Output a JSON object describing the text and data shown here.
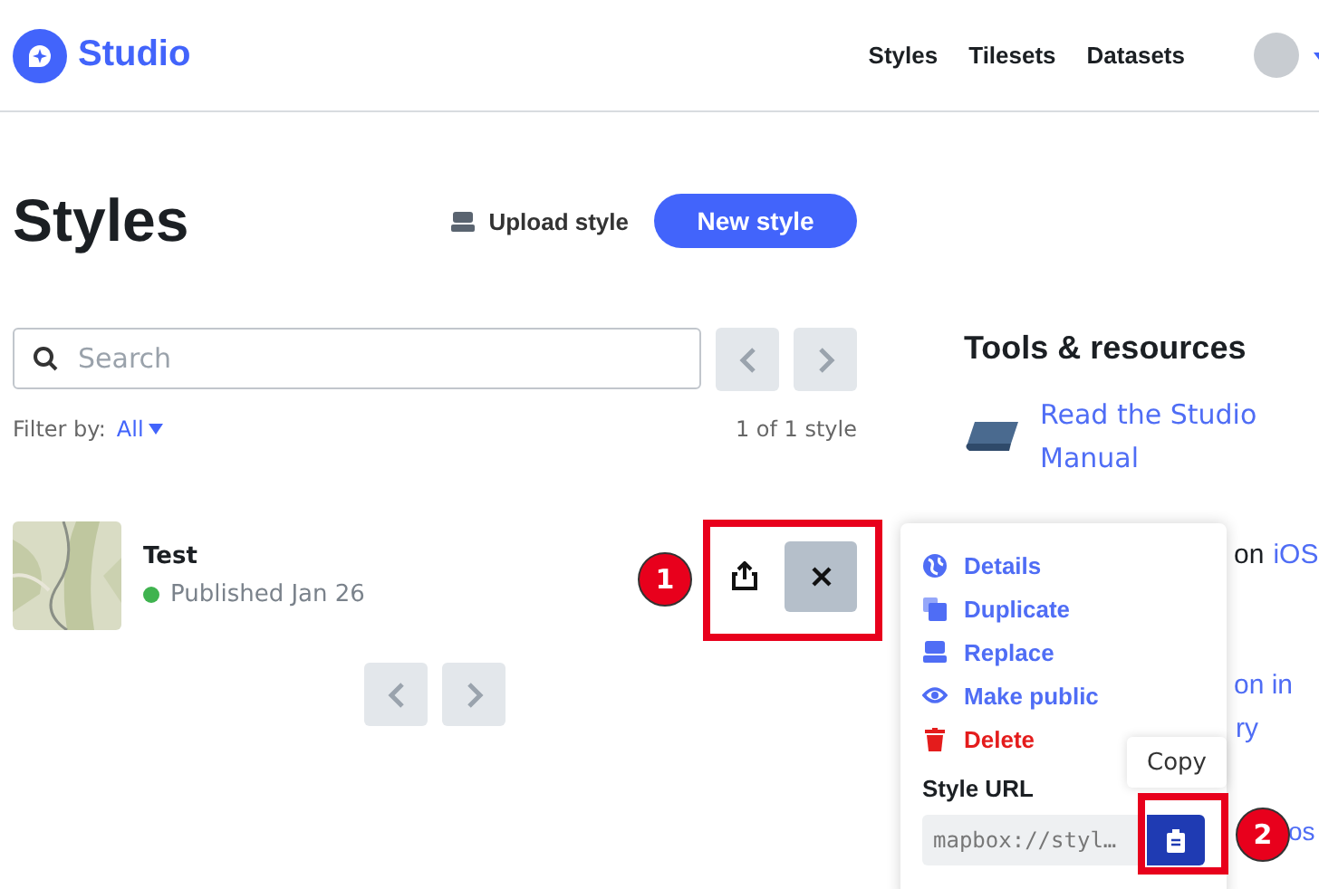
{
  "header": {
    "logo": "Studio",
    "nav": [
      {
        "label": "Styles"
      },
      {
        "label": "Tilesets"
      },
      {
        "label": "Datasets"
      }
    ]
  },
  "page": {
    "title": "Styles",
    "upload": "Upload style",
    "new_style": "New style"
  },
  "search": {
    "placeholder": "Search"
  },
  "filter": {
    "label": "Filter by:",
    "value": "All"
  },
  "count": "1 of 1 style",
  "styles": [
    {
      "name": "Test",
      "status": "Published Jan 26",
      "color": "#3fb34f"
    }
  ],
  "resources": {
    "title": "Tools & resources",
    "items": [
      {
        "text": "Read the Studio Manual"
      }
    ],
    "fragments": [
      "on",
      "iOS",
      "on in",
      "ry",
      "os"
    ]
  },
  "menu": {
    "items": [
      {
        "label": "Details",
        "kind": "globe"
      },
      {
        "label": "Duplicate",
        "kind": "copy"
      },
      {
        "label": "Replace",
        "kind": "drive"
      },
      {
        "label": "Make public",
        "kind": "eye"
      },
      {
        "label": "Delete",
        "kind": "trash"
      }
    ],
    "url_label": "Style URL",
    "url_value": "mapbox://styl…",
    "tooltip": "Copy"
  },
  "annotations": [
    {
      "number": "1"
    },
    {
      "number": "2"
    }
  ]
}
